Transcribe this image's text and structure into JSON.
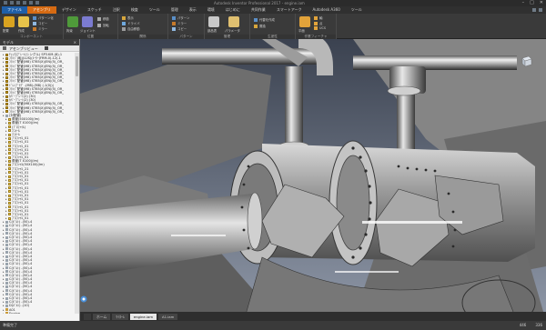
{
  "window": {
    "title": "Autodesk Inventor Professional 2017 - engine.iam",
    "controls": [
      "–",
      "□",
      "✕"
    ]
  },
  "ribbon": {
    "tabs": [
      "ファイル",
      "アセンブリ",
      "デザイン",
      "スケッチ",
      "注釈",
      "検査",
      "ツール",
      "管理",
      "表示",
      "環境",
      "はじめに",
      "共同作業",
      "スマートアーク",
      "Autodesk A360",
      "ツール"
    ],
    "active_tab_index": 1,
    "groups": [
      {
        "title": "コンポーネント",
        "buttons": [
          "配置",
          "作成",
          "パターン化",
          "コピー",
          "ミラー"
        ]
      },
      {
        "title": "位置",
        "buttons": [
          "拘束",
          "ジョイント",
          "移動",
          "回転"
        ]
      },
      {
        "title": "関係",
        "buttons": [
          "表示",
          "ドライバ",
          "自由移動"
        ]
      },
      {
        "title": "パターン",
        "buttons": [
          "パターン",
          "ミラー",
          "コピー"
        ]
      },
      {
        "title": "管理",
        "buttons": [
          "部品表",
          "パラメータ"
        ]
      },
      {
        "title": "生産性",
        "buttons": [
          "代替を作成",
          "置換"
        ]
      },
      {
        "title": "作業フィーチャ",
        "buttons": [
          "平面",
          "軸",
          "点",
          "UCS"
        ]
      }
    ]
  },
  "browser": {
    "title": "モデル",
    "close": "×",
    "tool_label": "アセンブリビュー",
    "tree_items": [
      {
        "label": "ﾁｪｯｸｽﾌﾟﾚｰﾄ(シングル) SP3.KM-(8)-1",
        "icon": "asm"
      },
      {
        "label": "ﾌﾗﾝｼﾞ(転)(LUS)(ﾒｰﾀｰ)FRM-0(-12)-1",
        "icon": "asm"
      },
      {
        "label": "ﾌﾗﾝｼﾞ配管(M8) ST65(X)(EN)(5)_OR_",
        "icon": "asm"
      },
      {
        "label": "ﾌﾗﾝｼﾞ配管(M8) ST65(X)(EN)(5)_OR_",
        "icon": "asm"
      },
      {
        "label": "ﾌﾗﾝｼﾞ配管(M8) ST65(X)(EN)(5)_OR_",
        "icon": "asm"
      },
      {
        "label": "ﾌﾗﾝｼﾞ配管(M8) ST65(X)(EN)(5)_OR_",
        "icon": "asm"
      },
      {
        "label": "ﾌﾗﾝｼﾞ配管(M8) ST65(X)(EN)(5)_OR_",
        "icon": "asm"
      },
      {
        "label": "ﾌﾗﾝｼﾞ配管(M8) ST65(X)(EN)(5)_OR_",
        "icon": "asm"
      },
      {
        "label": "ﾄﾞﾚﾝﾌﾟﾗｸﾞ -(M8)-(M8) (-1(0))(",
        "icon": "asm"
      },
      {
        "label": "ﾌﾗﾝｼﾞ配管(M8) ST65(X)(EN)(5)_OR_",
        "icon": "asm"
      },
      {
        "label": "ﾌﾗﾝｼﾞ配管(M8) ST65(X)(EN)(5)_OR_",
        "icon": "asm"
      },
      {
        "label": "ｶﾊﾞｰﾌﾞﾚｰﾄ(2) (30)",
        "icon": "asm"
      },
      {
        "label": "ｶﾊﾞｰﾌﾞﾚｰﾄ(2) (30)",
        "icon": "asm"
      },
      {
        "label": "ﾌﾗﾝｼﾞ配管(M8) ST65(X)(EN)(5)_OR_",
        "icon": "asm"
      },
      {
        "label": "ﾌﾗﾝｼﾞ配管(M8) ST65(X)(EN)(5)_OR_",
        "icon": "asm"
      },
      {
        "label": "ﾌﾗﾝｼﾞ配管(M8) ST65(X)(EN)(5)_OR_",
        "icon": "asm"
      },
      {
        "label": "(対配管)",
        "icon": "grp"
      },
      {
        "label": "角管(50X100)(Im)",
        "icon": "prt"
      },
      {
        "label": "角管(T X100)(Im)",
        "icon": "prt"
      },
      {
        "label": "(ﾌﾟﾛﾌｧｲﾙ)",
        "icon": "prt"
      },
      {
        "label": "ﾏﾆﾎｰﾙ",
        "icon": "prt"
      },
      {
        "label": "ﾏﾆﾎｰﾙ",
        "icon": "prt"
      },
      {
        "label": "ﾌﾟﾛﾌｧｲﾙ_01",
        "icon": "prt"
      },
      {
        "label": "ﾌﾟﾛﾌｧｲﾙ_01",
        "icon": "prt"
      },
      {
        "label": "ﾌﾟﾛﾌｧｲﾙ_01",
        "icon": "prt"
      },
      {
        "label": "ﾌﾟﾛﾌｧｲﾙ_01",
        "icon": "prt"
      },
      {
        "label": "ﾌﾟﾛﾌｧｲﾙ_01",
        "icon": "prt"
      },
      {
        "label": "ﾌﾟﾛﾌｧｲﾙ_01",
        "icon": "prt"
      },
      {
        "label": "角管(T X100)(Im)",
        "icon": "prt"
      },
      {
        "label": "ﾌﾟﾛﾌｧｲﾙ(50X100)(Im)",
        "icon": "prt"
      },
      {
        "label": "ﾌﾟﾛﾌｧｲﾙ_21",
        "icon": "prt"
      },
      {
        "label": "ﾌﾟﾛﾌｧｲﾙ_01",
        "icon": "prt"
      },
      {
        "label": "ﾌﾟﾛﾌｧｲﾙ_01",
        "icon": "prt"
      },
      {
        "label": "ﾌﾟﾛﾌｧｲﾙ_01",
        "icon": "prt"
      },
      {
        "label": "ﾌﾟﾛﾌｧｲﾙ_01",
        "icon": "prt"
      },
      {
        "label": "ﾌﾟﾛﾌｧｲﾙ_01",
        "icon": "prt"
      },
      {
        "label": "ﾌﾟﾛﾌｧｲﾙ_01",
        "icon": "prt"
      },
      {
        "label": "ﾌﾟﾛﾌｧｲﾙ_01",
        "icon": "prt"
      },
      {
        "label": "ﾌﾟﾛﾌｧｲﾙ_01",
        "icon": "prt"
      },
      {
        "label": "ﾌﾟﾛﾌｧｲﾙ_01",
        "icon": "prt"
      },
      {
        "label": "ﾌﾟﾛﾌｧｲﾙ_01",
        "icon": "prt"
      },
      {
        "label": "ﾌﾟﾛﾌｧｲﾙ_01",
        "icon": "prt"
      },
      {
        "label": "ﾌﾟﾛﾌｧｲﾙ_01",
        "icon": "prt"
      },
      {
        "label": "ﾌﾟﾛﾌｧｲﾙ_01",
        "icon": "prt"
      },
      {
        "label": "C(ﾎﾞﾙﾄ) -(50)-4",
        "icon": "grp"
      },
      {
        "label": "C(ﾎﾞﾙﾄ) -(50)-4",
        "icon": "grp"
      },
      {
        "label": "C(ﾎﾞﾙﾄ) -(50)-4",
        "icon": "grp"
      },
      {
        "label": "C(ﾎﾞﾙﾄ) -(50)-4",
        "icon": "grp"
      },
      {
        "label": "C(ﾎﾞﾙﾄ) -(50)-4",
        "icon": "grp"
      },
      {
        "label": "C(ﾎﾞﾙﾄ) -(50)-4",
        "icon": "grp"
      },
      {
        "label": "C(ﾎﾞﾙﾄ) -(50)-4",
        "icon": "grp"
      },
      {
        "label": "C(ﾎﾞﾙﾄ) -(50)-4",
        "icon": "grp"
      },
      {
        "label": "C(ﾎﾞﾙﾄ) -(50)-4",
        "icon": "grp"
      },
      {
        "label": "C(ﾎﾞﾙﾄ) -(50)-4",
        "icon": "grp"
      },
      {
        "label": "C(ﾎﾞﾙﾄ) -(50)-4",
        "icon": "grp"
      },
      {
        "label": "C(ﾎﾞﾙﾄ) -(50)-4",
        "icon": "grp"
      },
      {
        "label": "C(ﾎﾞﾙﾄ) -(50)-4",
        "icon": "grp"
      },
      {
        "label": "C(ﾎﾞﾙﾄ) -(50)-4",
        "icon": "grp"
      },
      {
        "label": "C(ﾎﾞﾙﾄ) -(50)-4",
        "icon": "grp"
      },
      {
        "label": "C(ﾎﾞﾙﾄ) -(50)-4",
        "icon": "grp"
      },
      {
        "label": "C(ﾎﾞﾙﾄ) -(50)-4",
        "icon": "grp"
      },
      {
        "label": "C(ﾎﾞﾙﾄ) -(50)-4",
        "icon": "grp"
      },
      {
        "label": "C(ﾎﾞﾙﾄ) -(50)-4",
        "icon": "grp"
      },
      {
        "label": "C(ﾎﾞﾙﾄ) -(50)-4",
        "icon": "grp"
      },
      {
        "label": "C(ﾎﾞﾙﾄ) -(50)-4",
        "icon": "grp"
      },
      {
        "label": "C(ﾎﾞﾙﾄ) -(50)-4",
        "icon": "grp"
      },
      {
        "label": "D(ﾎﾞﾙﾄ) -(10)",
        "icon": "grp"
      },
      {
        "label": "A01",
        "icon": "box"
      },
      {
        "label": "Engine",
        "icon": "box"
      },
      {
        "label": "ﾌﾟﾛﾌｧｲﾙ",
        "icon": "prt"
      },
      {
        "label": "角管(T X100)(Im)",
        "icon": "prt"
      }
    ]
  },
  "document_tabs": [
    "ホーム",
    "ﾏｲﾎｰﾑ",
    "engine.iam",
    "A1.iam"
  ],
  "active_doc_tab": 2,
  "status": {
    "left": "準備完了",
    "right_values": [
      "446",
      "336"
    ]
  },
  "colors": {
    "accent": "#d66a12",
    "file_tab": "#1f5fa8",
    "ribbon_bg": "#3a3a3a"
  }
}
